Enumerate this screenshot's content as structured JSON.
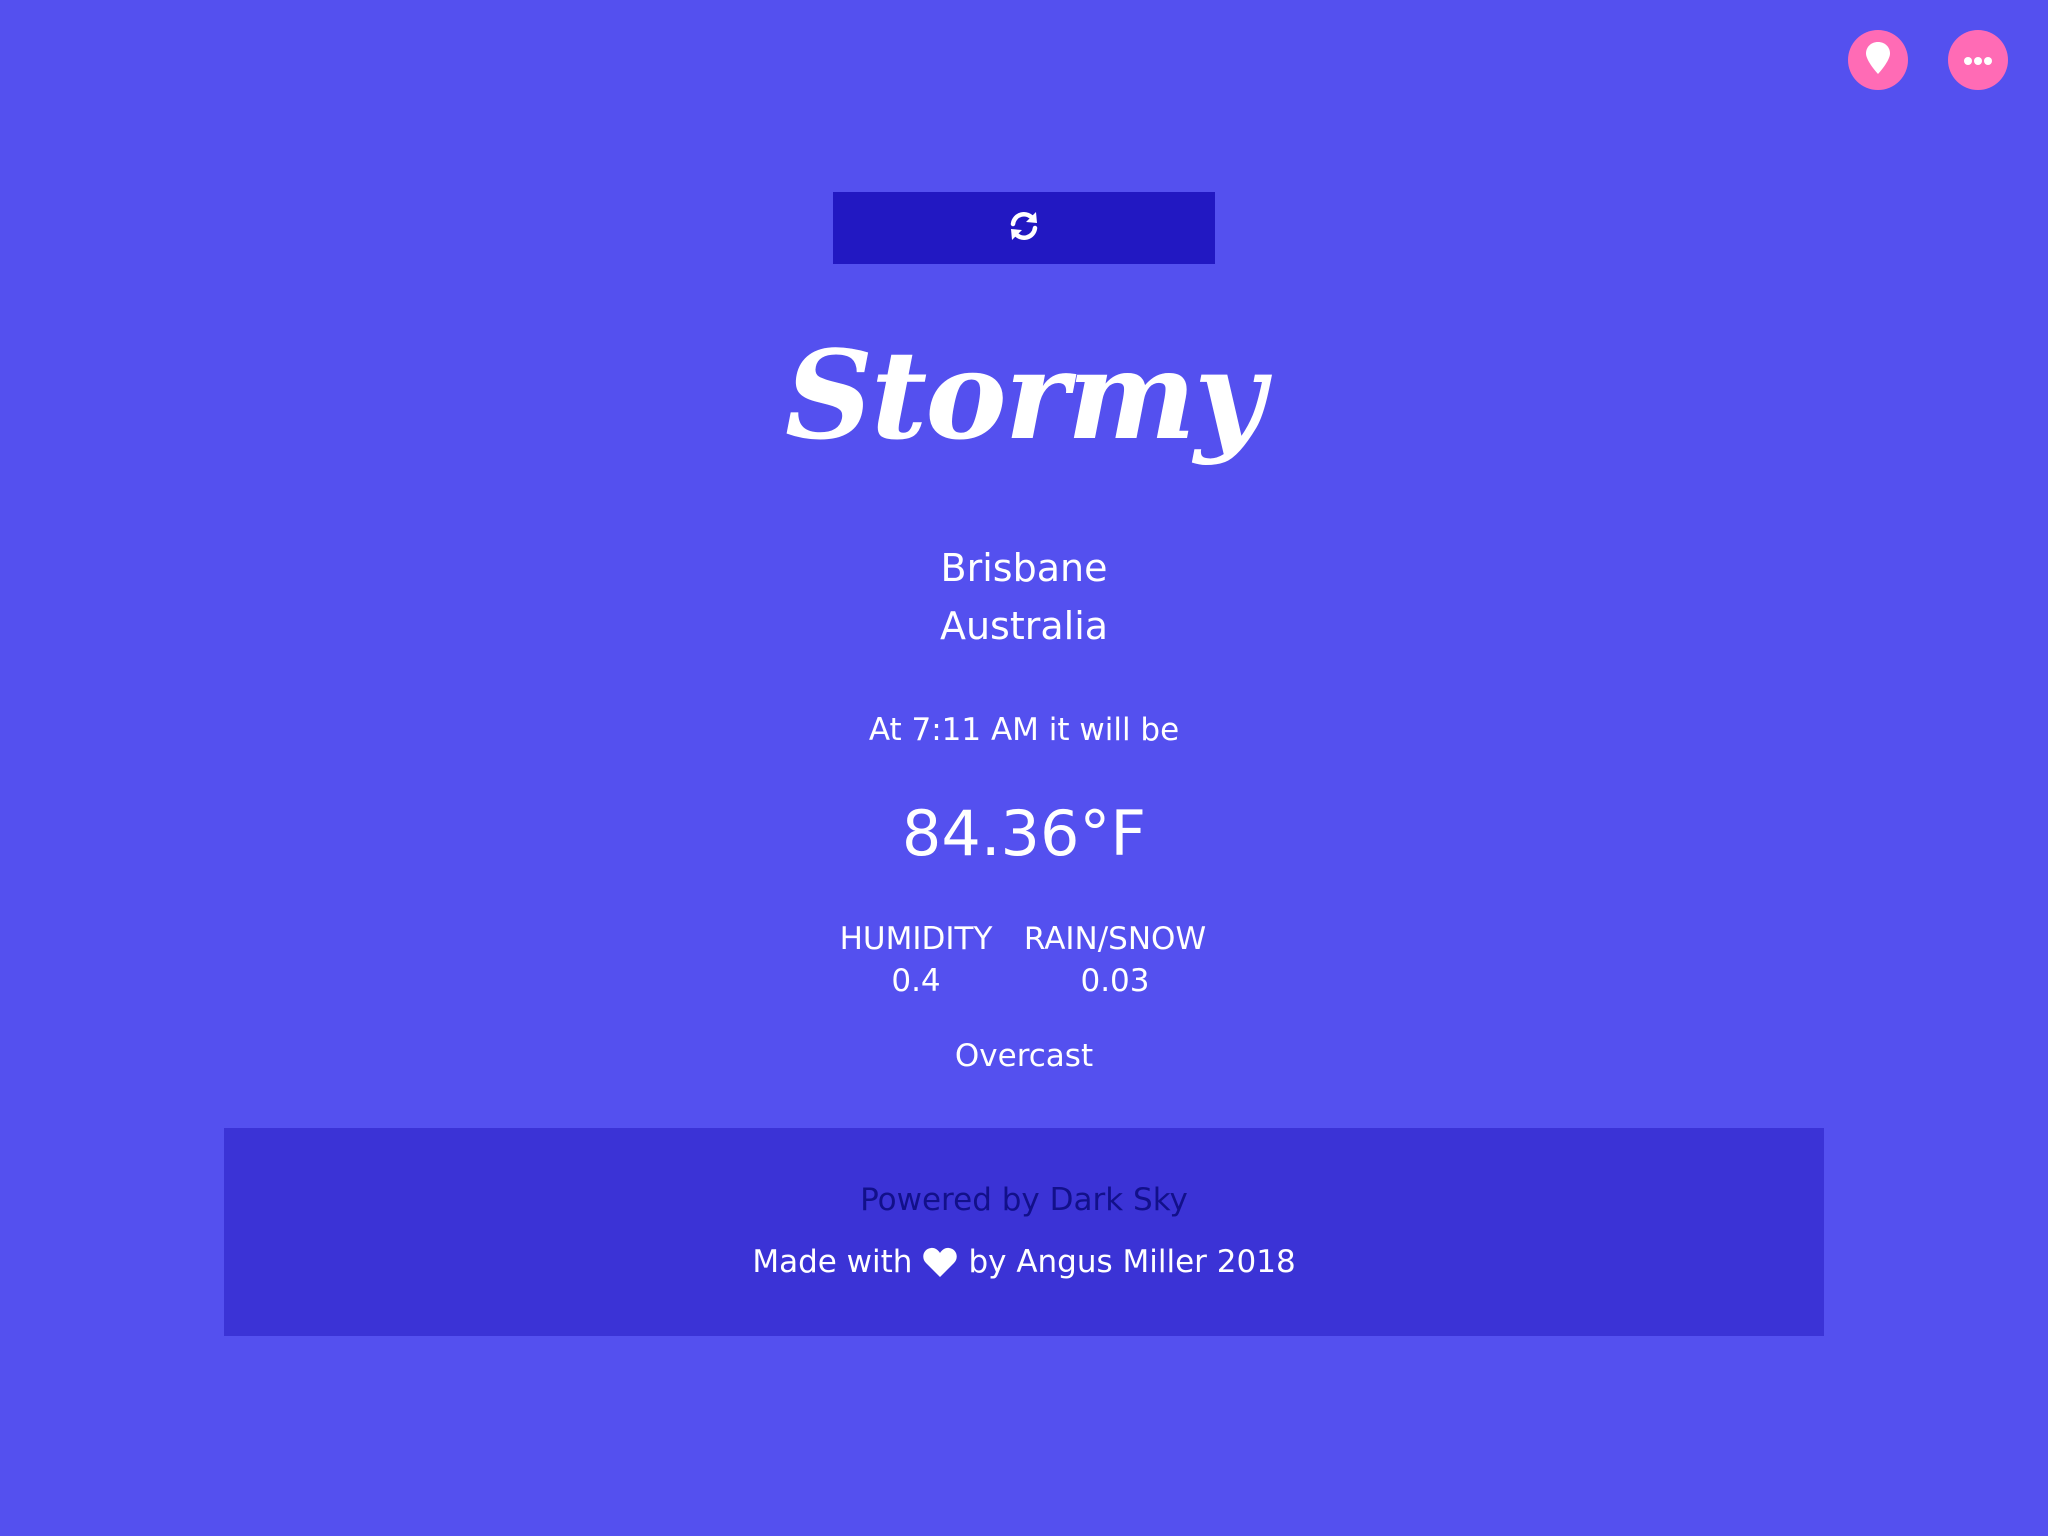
{
  "app": {
    "title": "Stormy",
    "refresh_icon": "refresh-icon"
  },
  "actions": {
    "location_icon": "map-pin-icon",
    "more_icon": "ellipsis-icon",
    "accent_color": "#ff6bb5"
  },
  "location": {
    "city": "Brisbane",
    "country": "Australia"
  },
  "forecast": {
    "time_text": "At 7:11 AM it will be",
    "temperature": "84.36°F",
    "humidity_label": "HUMIDITY",
    "humidity_value": "0.4",
    "precip_label": "RAIN/SNOW",
    "precip_value": "0.03",
    "summary": "Overcast"
  },
  "footer": {
    "powered_by": "Powered by Dark Sky",
    "made_with_prefix": "Made with",
    "made_with_suffix": "by Angus Miller 2018",
    "heart_icon": "heart-icon"
  },
  "colors": {
    "background": "#5450ef",
    "refresh_bar": "#2218c2",
    "footer_bg": "#3b33d6",
    "powered_text": "#12108a"
  }
}
